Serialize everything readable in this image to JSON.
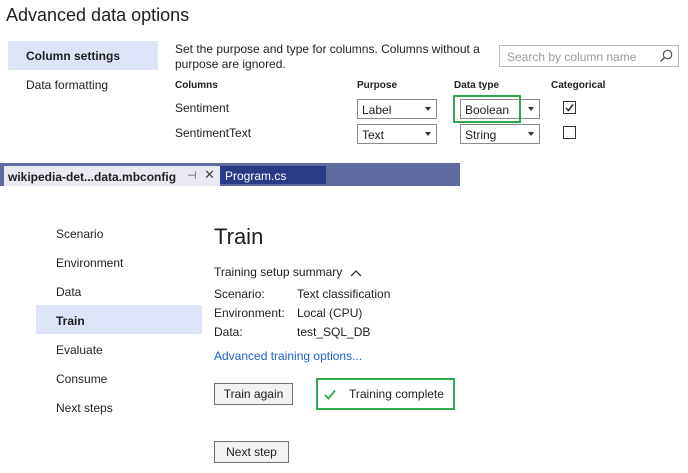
{
  "dialog": {
    "title": "Advanced data options",
    "nav": [
      {
        "label": "Column settings",
        "selected": true
      },
      {
        "label": "Data formatting",
        "selected": false
      }
    ],
    "description": "Set the purpose and type for columns. Columns without a purpose are ignored.",
    "search_placeholder": "Search by column name",
    "table": {
      "headers": {
        "columns": "Columns",
        "purpose": "Purpose",
        "data_type": "Data type",
        "categorical": "Categorical"
      },
      "rows": [
        {
          "column": "Sentiment",
          "purpose": "Label",
          "data_type": "Boolean",
          "categorical": true
        },
        {
          "column": "SentimentText",
          "purpose": "Text",
          "data_type": "String",
          "categorical": false
        }
      ]
    }
  },
  "tabs": [
    {
      "label": "wikipedia-det...data.mbconfig",
      "active": true
    },
    {
      "label": "Program.cs",
      "active": false
    }
  ],
  "tab_icons": {
    "pin": "⊣",
    "close": "✕"
  },
  "builder": {
    "nav": [
      "Scenario",
      "Environment",
      "Data",
      "Train",
      "Evaluate",
      "Consume",
      "Next steps"
    ],
    "active_nav": "Train",
    "page_title": "Train",
    "summary_toggle": "Training setup summary",
    "summary": [
      {
        "key": "Scenario:",
        "value": "Text classification"
      },
      {
        "key": "Environment:",
        "value": "Local (CPU)"
      },
      {
        "key": "Data:",
        "value": "test_SQL_DB"
      }
    ],
    "advanced_link": "Advanced training options...",
    "train_again_label": "Train again",
    "status": "Training complete",
    "next_step_label": "Next step"
  },
  "colors": {
    "accent_green": "#2fa84f",
    "selected_bg": "#dde4f7",
    "link": "#1b62c9",
    "tabbar": "#5f6a9f",
    "tab_inactive": "#2b3a87"
  }
}
